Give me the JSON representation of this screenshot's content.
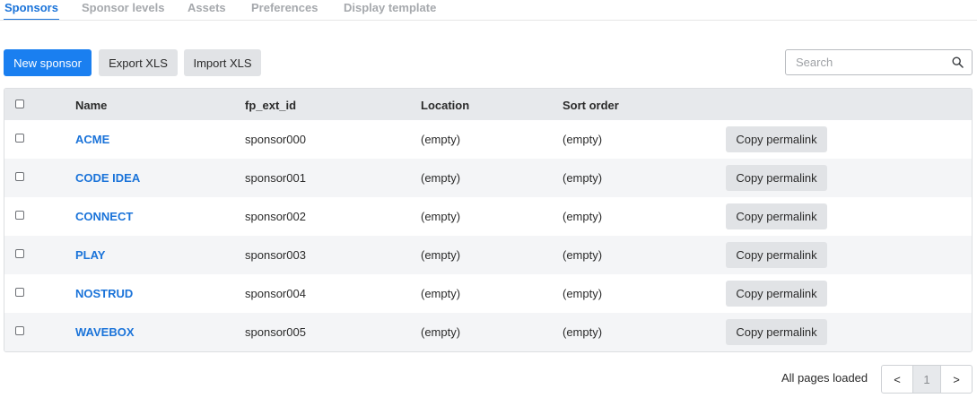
{
  "tabs": [
    {
      "label": "Sponsors",
      "active": true
    },
    {
      "label": "Sponsor levels",
      "active": false
    },
    {
      "label": "Assets",
      "active": false
    },
    {
      "label": "Preferences",
      "active": false
    },
    {
      "label": "Display template",
      "active": false
    }
  ],
  "toolbar": {
    "new_label": "New sponsor",
    "export_label": "Export XLS",
    "import_label": "Import XLS"
  },
  "search": {
    "placeholder": "Search",
    "value": ""
  },
  "table": {
    "columns": [
      "Name",
      "fp_ext_id",
      "Location",
      "Sort order"
    ],
    "rows": [
      {
        "name": "ACME",
        "ext_id": "sponsor000",
        "location": "(empty)",
        "sort_order": "(empty)",
        "action": "Copy permalink"
      },
      {
        "name": "CODE IDEA",
        "ext_id": "sponsor001",
        "location": "(empty)",
        "sort_order": "(empty)",
        "action": "Copy permalink"
      },
      {
        "name": "CONNECT",
        "ext_id": "sponsor002",
        "location": "(empty)",
        "sort_order": "(empty)",
        "action": "Copy permalink"
      },
      {
        "name": "PLAY",
        "ext_id": "sponsor003",
        "location": "(empty)",
        "sort_order": "(empty)",
        "action": "Copy permalink"
      },
      {
        "name": "NOSTRUD",
        "ext_id": "sponsor004",
        "location": "(empty)",
        "sort_order": "(empty)",
        "action": "Copy permalink"
      },
      {
        "name": "WAVEBOX",
        "ext_id": "sponsor005",
        "location": "(empty)",
        "sort_order": "(empty)",
        "action": "Copy permalink"
      }
    ]
  },
  "pagination": {
    "status": "All pages loaded",
    "prev": "<",
    "current_page": "1",
    "next": ">"
  },
  "colors": {
    "accent": "#1a73d9",
    "primary_button": "#1a7ff0",
    "header_bg": "#e7e9ec",
    "alt_row_bg": "#f4f5f7"
  }
}
